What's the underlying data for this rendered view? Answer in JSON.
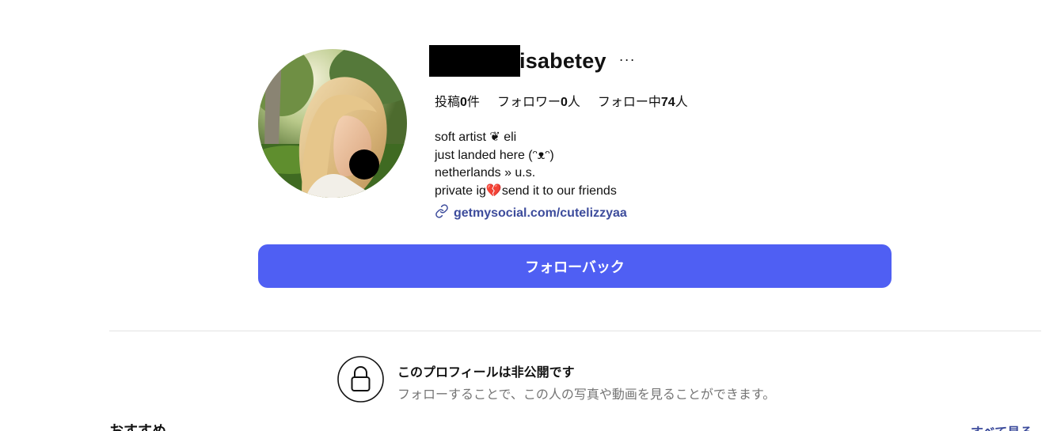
{
  "profile": {
    "username": "isabetey",
    "more_label": "···",
    "stats": {
      "posts_label": "投稿",
      "posts_count": "0",
      "posts_unit": "件",
      "followers_label": "フォロワー",
      "followers_count": "0",
      "followers_unit": "人",
      "following_label": "フォロー中",
      "following_count": "74",
      "following_unit": "人"
    },
    "bio": [
      "soft artist ❦ eli",
      "just landed here (ᵔᴥᵔ)",
      "netherlands » u.s.",
      "private ig💔send it to our friends"
    ],
    "link": "getmysocial.com/cutelizzyaa"
  },
  "actions": {
    "follow_back_label": "フォローバック"
  },
  "private_notice": {
    "title": "このプロフィールは非公開です",
    "subtitle": "フォローすることで、この人の写真や動画を見ることができます。"
  },
  "recommendations": {
    "heading": "おすすめ",
    "see_all_label": "すべて見る"
  },
  "colors": {
    "accent": "#4f5ff3",
    "link": "#3d4c9c",
    "muted_text": "#757575",
    "divider": "#e3e3e3"
  },
  "icons": {
    "more": "ellipsis-icon",
    "link": "link-icon",
    "lock": "lock-icon"
  }
}
